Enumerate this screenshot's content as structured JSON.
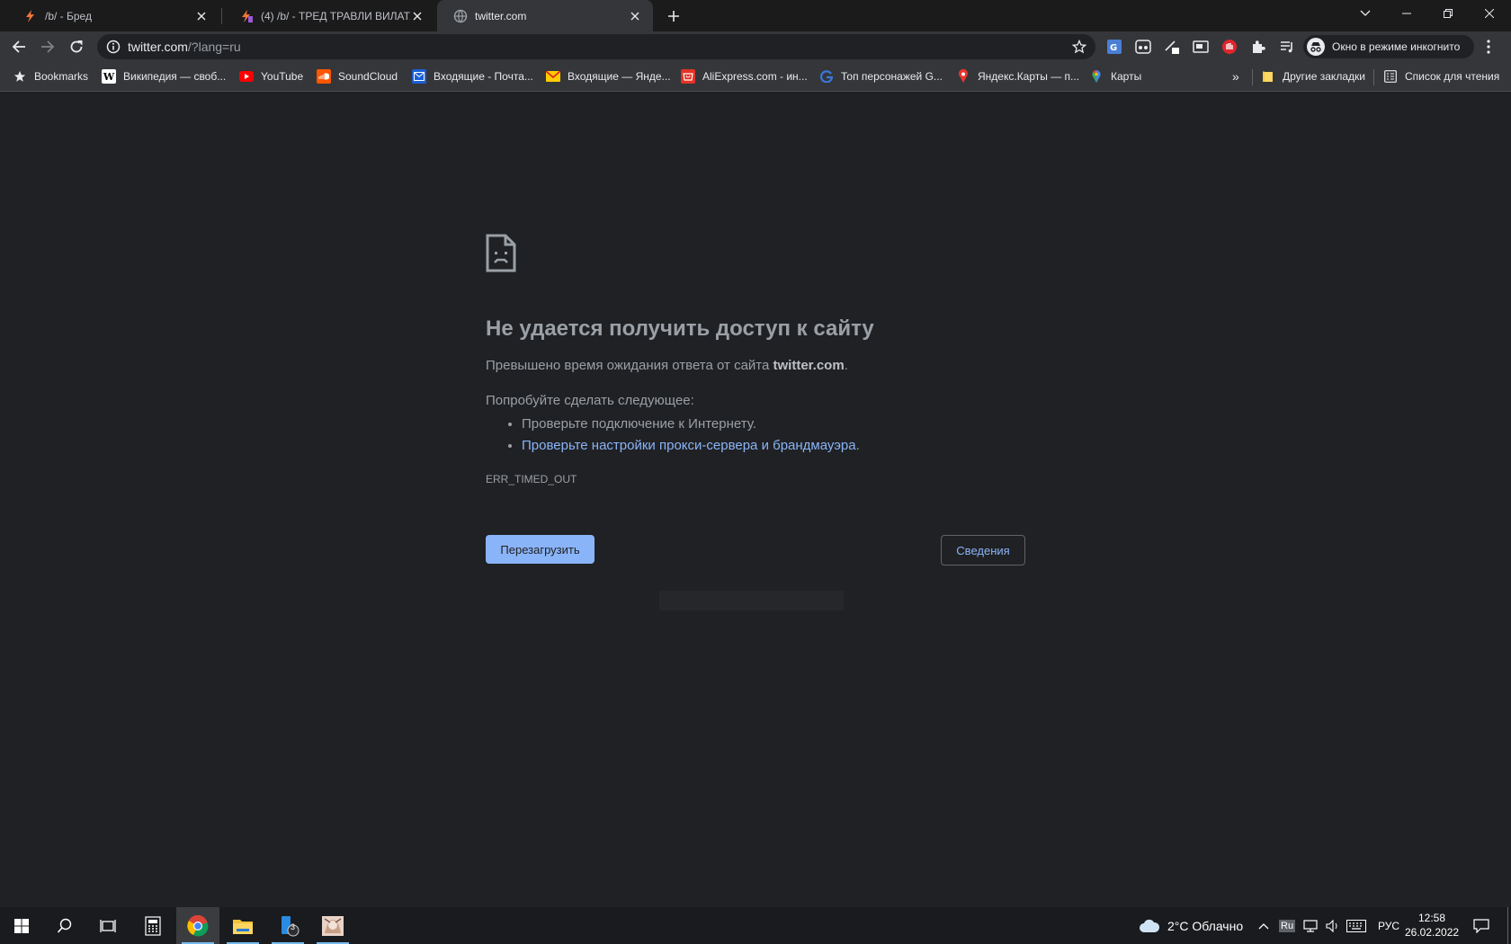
{
  "tabs": [
    {
      "title": "/b/ - Бред",
      "favicon": "lightning-icon",
      "active": false
    },
    {
      "title": "(4) /b/ - ТРЕД ТРАВЛИ ВИЛАТА",
      "favicon": "lightning-icon",
      "active": false
    },
    {
      "title": "twitter.com",
      "favicon": "globe-icon",
      "active": true
    }
  ],
  "address_bar": {
    "host": "twitter.com",
    "path": "/?lang=ru"
  },
  "incognito_label": "Окно в режиме инкогнито",
  "bookmarks": {
    "items": [
      {
        "label": "Bookmarks",
        "icon": "star-icon"
      },
      {
        "label": "Википедия — своб...",
        "icon": "wikipedia-icon"
      },
      {
        "label": "YouTube",
        "icon": "youtube-icon"
      },
      {
        "label": "SoundCloud",
        "icon": "soundcloud-icon"
      },
      {
        "label": "Входящие - Почта...",
        "icon": "mail-icon"
      },
      {
        "label": "Входящие — Янде...",
        "icon": "yandex-mail-icon"
      },
      {
        "label": "AliExpress.com - ин...",
        "icon": "aliexpress-icon"
      },
      {
        "label": "Топ персонажей G...",
        "icon": "g-icon"
      },
      {
        "label": "Яндекс.Карты — п...",
        "icon": "map-pin-icon"
      },
      {
        "label": "Карты",
        "icon": "google-maps-icon"
      }
    ],
    "overflow": "»",
    "other_bookmarks": "Другие закладки",
    "reading_list": "Список для чтения"
  },
  "error_page": {
    "heading": "Не удается получить доступ к сайту",
    "description_prefix": "Превышено время ожидания ответа от сайта ",
    "description_host": "twitter.com",
    "description_suffix": ".",
    "suggestions_title": "Попробуйте сделать следующее:",
    "suggestion_1": "Проверьте подключение к Интернету.",
    "suggestion_2": "Проверьте настройки прокси-сервера и брандмауэра",
    "suggestion_2_suffix": ".",
    "error_code": "ERR_TIMED_OUT",
    "reload_button": "Перезагрузить",
    "details_button": "Сведения"
  },
  "taskbar": {
    "weather": "2°C  Облачно",
    "input_indicator": "Ru",
    "language": "РУС",
    "time": "12:58",
    "date": "26.02.2022",
    "badge_count": "3"
  },
  "colors": {
    "page_bg": "#202124",
    "toolbar_bg": "#35363a",
    "link": "#8ab4f8",
    "button_primary": "#8ab4f8"
  }
}
